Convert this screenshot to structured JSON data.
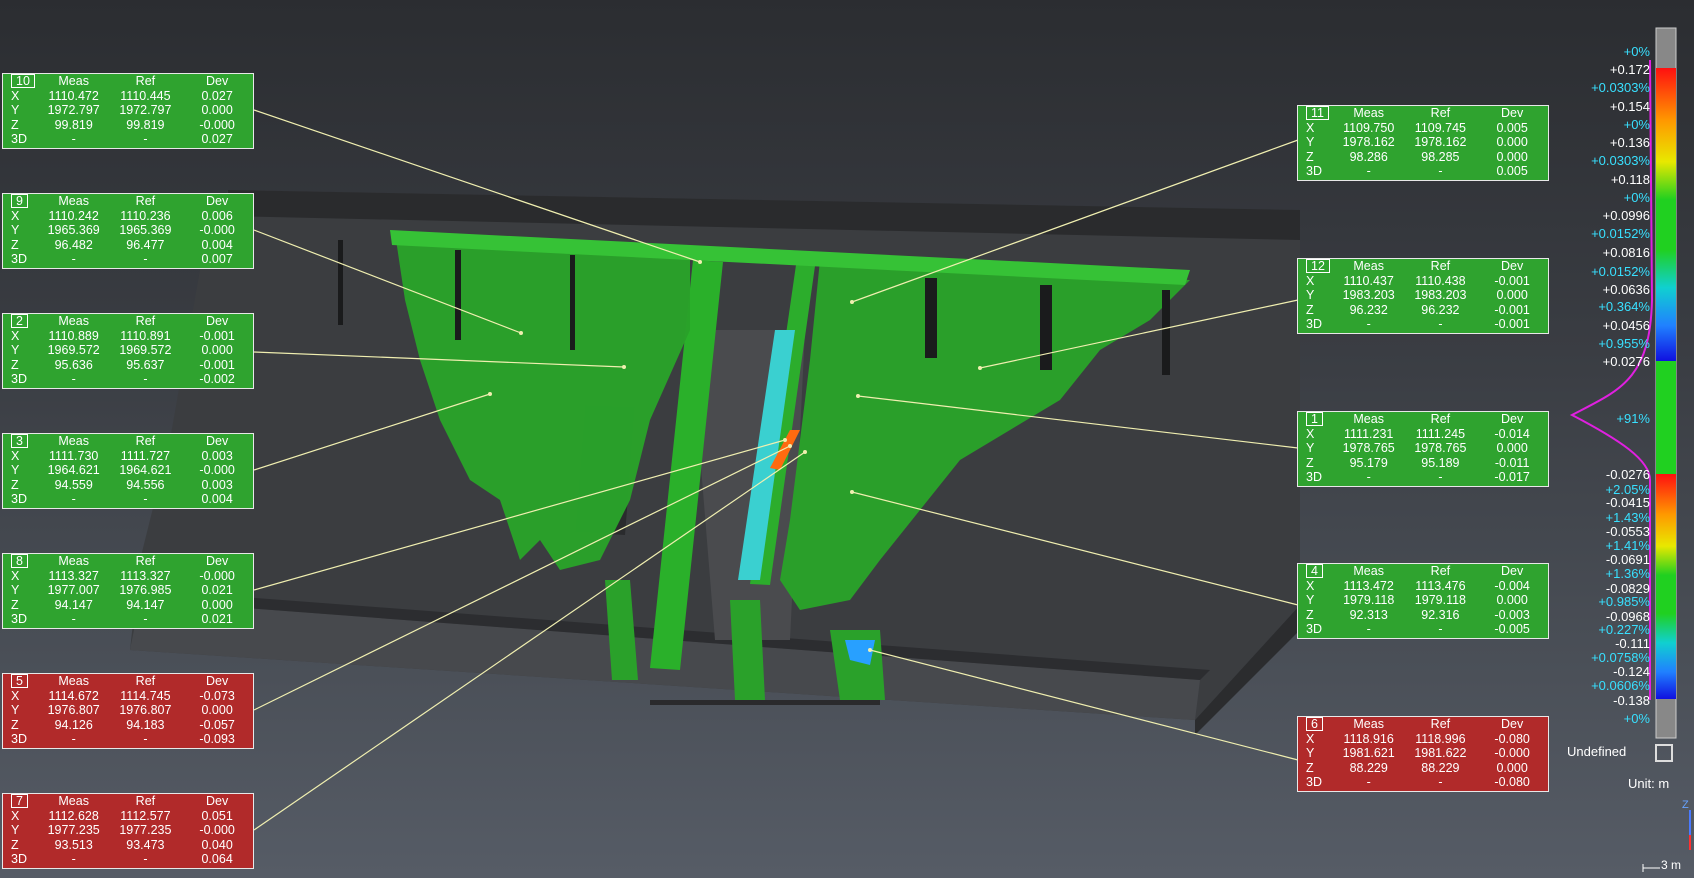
{
  "callouts": [
    {
      "id": "10",
      "color": "green",
      "header": [
        "Meas",
        "Ref",
        "Dev"
      ],
      "rows": [
        [
          "X",
          "1110.472",
          "1110.445",
          "0.027"
        ],
        [
          "Y",
          "1972.797",
          "1972.797",
          "0.000"
        ],
        [
          "Z",
          "99.819",
          "99.819",
          "-0.000"
        ],
        [
          "3D",
          "-",
          "-",
          "0.027"
        ]
      ]
    },
    {
      "id": "9",
      "color": "green",
      "header": [
        "Meas",
        "Ref",
        "Dev"
      ],
      "rows": [
        [
          "X",
          "1110.242",
          "1110.236",
          "0.006"
        ],
        [
          "Y",
          "1965.369",
          "1965.369",
          "-0.000"
        ],
        [
          "Z",
          "96.482",
          "96.477",
          "0.004"
        ],
        [
          "3D",
          "-",
          "-",
          "0.007"
        ]
      ]
    },
    {
      "id": "2",
      "color": "green",
      "header": [
        "Meas",
        "Ref",
        "Dev"
      ],
      "rows": [
        [
          "X",
          "1110.889",
          "1110.891",
          "-0.001"
        ],
        [
          "Y",
          "1969.572",
          "1969.572",
          "0.000"
        ],
        [
          "Z",
          "95.636",
          "95.637",
          "-0.001"
        ],
        [
          "3D",
          "-",
          "-",
          "-0.002"
        ]
      ]
    },
    {
      "id": "3",
      "color": "green",
      "header": [
        "Meas",
        "Ref",
        "Dev"
      ],
      "rows": [
        [
          "X",
          "1111.730",
          "1111.727",
          "0.003"
        ],
        [
          "Y",
          "1964.621",
          "1964.621",
          "-0.000"
        ],
        [
          "Z",
          "94.559",
          "94.556",
          "0.003"
        ],
        [
          "3D",
          "-",
          "-",
          "0.004"
        ]
      ]
    },
    {
      "id": "8",
      "color": "green",
      "header": [
        "Meas",
        "Ref",
        "Dev"
      ],
      "rows": [
        [
          "X",
          "1113.327",
          "1113.327",
          "-0.000"
        ],
        [
          "Y",
          "1977.007",
          "1976.985",
          "0.021"
        ],
        [
          "Z",
          "94.147",
          "94.147",
          "0.000"
        ],
        [
          "3D",
          "-",
          "-",
          "0.021"
        ]
      ]
    },
    {
      "id": "5",
      "color": "red",
      "header": [
        "Meas",
        "Ref",
        "Dev"
      ],
      "rows": [
        [
          "X",
          "1114.672",
          "1114.745",
          "-0.073"
        ],
        [
          "Y",
          "1976.807",
          "1976.807",
          "0.000"
        ],
        [
          "Z",
          "94.126",
          "94.183",
          "-0.057"
        ],
        [
          "3D",
          "-",
          "-",
          "-0.093"
        ]
      ]
    },
    {
      "id": "7",
      "color": "red",
      "header": [
        "Meas",
        "Ref",
        "Dev"
      ],
      "rows": [
        [
          "X",
          "1112.628",
          "1112.577",
          "0.051"
        ],
        [
          "Y",
          "1977.235",
          "1977.235",
          "-0.000"
        ],
        [
          "Z",
          "93.513",
          "93.473",
          "0.040"
        ],
        [
          "3D",
          "-",
          "-",
          "0.064"
        ]
      ]
    },
    {
      "id": "11",
      "color": "green",
      "header": [
        "Meas",
        "Ref",
        "Dev"
      ],
      "rows": [
        [
          "X",
          "1109.750",
          "1109.745",
          "0.005"
        ],
        [
          "Y",
          "1978.162",
          "1978.162",
          "0.000"
        ],
        [
          "Z",
          "98.286",
          "98.285",
          "0.000"
        ],
        [
          "3D",
          "-",
          "-",
          "0.005"
        ]
      ]
    },
    {
      "id": "12",
      "color": "green",
      "header": [
        "Meas",
        "Ref",
        "Dev"
      ],
      "rows": [
        [
          "X",
          "1110.437",
          "1110.438",
          "-0.001"
        ],
        [
          "Y",
          "1983.203",
          "1983.203",
          "0.000"
        ],
        [
          "Z",
          "96.232",
          "96.232",
          "-0.001"
        ],
        [
          "3D",
          "-",
          "-",
          "-0.001"
        ]
      ]
    },
    {
      "id": "1",
      "color": "green",
      "header": [
        "Meas",
        "Ref",
        "Dev"
      ],
      "rows": [
        [
          "X",
          "1111.231",
          "1111.245",
          "-0.014"
        ],
        [
          "Y",
          "1978.765",
          "1978.765",
          "0.000"
        ],
        [
          "Z",
          "95.179",
          "95.189",
          "-0.011"
        ],
        [
          "3D",
          "-",
          "-",
          "-0.017"
        ]
      ]
    },
    {
      "id": "4",
      "color": "green",
      "header": [
        "Meas",
        "Ref",
        "Dev"
      ],
      "rows": [
        [
          "X",
          "1113.472",
          "1113.476",
          "-0.004"
        ],
        [
          "Y",
          "1979.118",
          "1979.118",
          "0.000"
        ],
        [
          "Z",
          "92.313",
          "92.316",
          "-0.003"
        ],
        [
          "3D",
          "-",
          "-",
          "-0.005"
        ]
      ]
    },
    {
      "id": "6",
      "color": "red",
      "header": [
        "Meas",
        "Ref",
        "Dev"
      ],
      "rows": [
        [
          "X",
          "1118.916",
          "1118.996",
          "-0.080"
        ],
        [
          "Y",
          "1981.621",
          "1981.622",
          "-0.000"
        ],
        [
          "Z",
          "88.229",
          "88.229",
          "0.000"
        ],
        [
          "3D",
          "-",
          "-",
          "-0.080"
        ]
      ]
    }
  ],
  "color_scale": {
    "labels": [
      {
        "text": "+0%",
        "kind": "c"
      },
      {
        "text": "+0.172",
        "kind": "w"
      },
      {
        "text": "+0.0303%",
        "kind": "c"
      },
      {
        "text": "+0.154",
        "kind": "w"
      },
      {
        "text": "+0%",
        "kind": "c"
      },
      {
        "text": "+0.136",
        "kind": "w"
      },
      {
        "text": "+0.0303%",
        "kind": "c"
      },
      {
        "text": "+0.118",
        "kind": "w"
      },
      {
        "text": "+0%",
        "kind": "c"
      },
      {
        "text": "+0.0996",
        "kind": "w"
      },
      {
        "text": "+0.0152%",
        "kind": "c"
      },
      {
        "text": "+0.0816",
        "kind": "w"
      },
      {
        "text": "+0.0152%",
        "kind": "c"
      },
      {
        "text": "+0.0636",
        "kind": "w"
      },
      {
        "text": "+0.364%",
        "kind": "c"
      },
      {
        "text": "+0.0456",
        "kind": "w"
      },
      {
        "text": "+0.955%",
        "kind": "c"
      },
      {
        "text": "+0.0276",
        "kind": "w"
      },
      {
        "text": "+91%",
        "kind": "c"
      },
      {
        "text": "-0.0276",
        "kind": "w"
      },
      {
        "text": "+2.05%",
        "kind": "c"
      },
      {
        "text": "-0.0415",
        "kind": "w"
      },
      {
        "text": "+1.43%",
        "kind": "c"
      },
      {
        "text": "-0.0553",
        "kind": "w"
      },
      {
        "text": "+1.41%",
        "kind": "c"
      },
      {
        "text": "-0.0691",
        "kind": "w"
      },
      {
        "text": "+1.36%",
        "kind": "c"
      },
      {
        "text": "-0.0829",
        "kind": "w"
      },
      {
        "text": "+0.985%",
        "kind": "c"
      },
      {
        "text": "-0.0968",
        "kind": "w"
      },
      {
        "text": "+0.227%",
        "kind": "c"
      },
      {
        "text": "-0.111",
        "kind": "w"
      },
      {
        "text": "+0.0758%",
        "kind": "c"
      },
      {
        "text": "-0.124",
        "kind": "w"
      },
      {
        "text": "+0.0606%",
        "kind": "c"
      },
      {
        "text": "-0.138",
        "kind": "w"
      },
      {
        "text": "+0%",
        "kind": "c"
      }
    ],
    "undefined_label": "Undefined",
    "unit_label": "Unit: m"
  },
  "axis_label": "Z",
  "scale_bar_label": "3 m",
  "colors": {
    "within_tol": "#2fa32f",
    "out_of_tol": "#b12a2a",
    "label_cyan": "#38e0ff",
    "histogram": "#e020e0"
  }
}
